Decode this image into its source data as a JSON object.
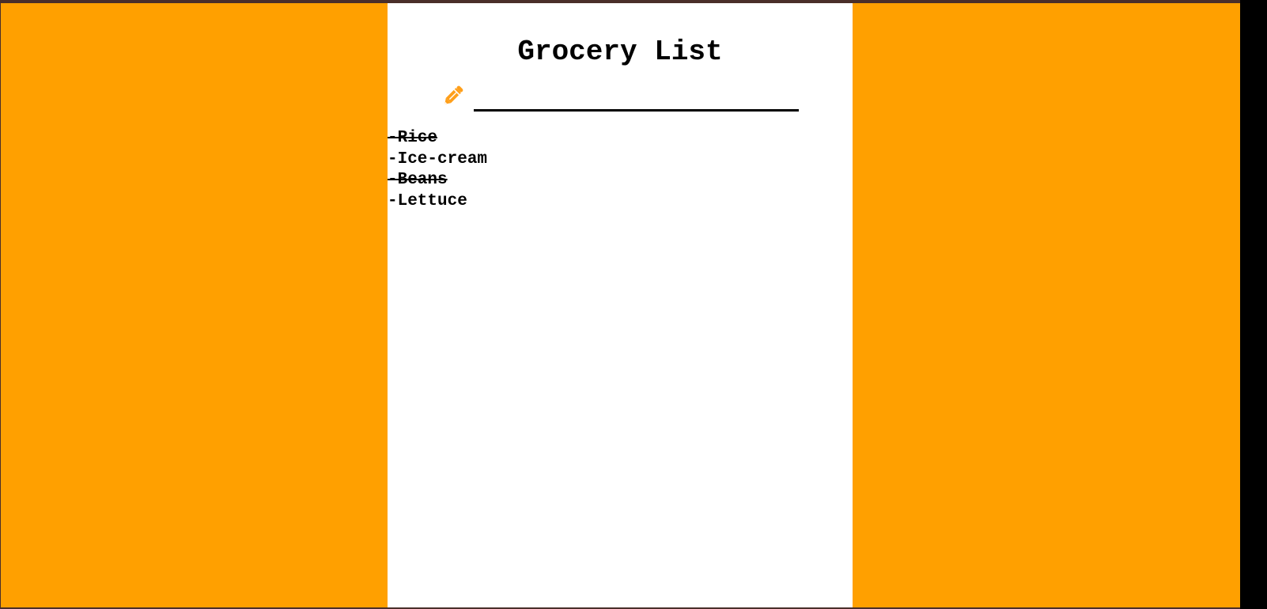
{
  "page": {
    "title": "Grocery List",
    "background_color": "#ffa000",
    "paper_color": "#ffffff",
    "accent_color": "#ff9f1a"
  },
  "input": {
    "value": "",
    "placeholder": "",
    "icon": "pencil-icon"
  },
  "items": [
    {
      "text": "-Rice",
      "done": true
    },
    {
      "text": "-Ice-cream",
      "done": false
    },
    {
      "text": "-Beans",
      "done": true
    },
    {
      "text": "-Lettuce",
      "done": false
    }
  ]
}
